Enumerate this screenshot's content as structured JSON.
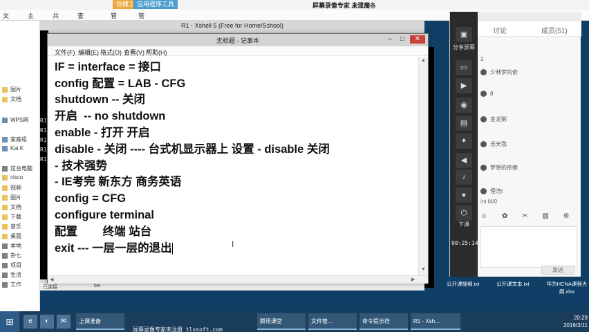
{
  "explorer": {
    "ctx_tab_a": "快捷工具",
    "ctx_tab_b": "应用程序工具",
    "recorder_title": "屏幕录像专家 未注册",
    "window_title": "上课准备",
    "ribbon_tabs": [
      "文件",
      "主页",
      "共享",
      "查看",
      "管理",
      "管理"
    ],
    "nav_items": [
      "图片",
      "文档",
      "WPS网",
      "家庭组",
      "Kai K",
      "这台电脑",
      "cisco",
      "视频",
      "图片",
      "文档",
      "下载",
      "音乐",
      "桌面",
      "本地",
      "杂七",
      "项目",
      "生活",
      "工作"
    ]
  },
  "xshell": {
    "title": "R1 - Xshell 5 (Free for Home/School)",
    "term_lines": [
      "R1",
      "R1",
      "R1",
      "R1",
      "R1"
    ],
    "bottom_text": "已连接",
    "bottom_text2": "bin"
  },
  "notepad": {
    "title": "无标题 - 记事本",
    "menu": [
      "文件(F)",
      "编辑(E)",
      "格式(O)",
      "查看(V)",
      "帮助(H)"
    ],
    "lines": [
      "IF = interface = 接口",
      "config 配置 = LAB - CFG",
      "shutdown -- 关闭",
      "开启  -- no shutdown",
      "enable - 打开 开启",
      "disable - 关闭 ---- 台式机显示器上 设置 - disable 关闭",
      "- 技术强势",
      "- IE考完 新东方 商务英语",
      "config = CFG",
      "configure terminal",
      "配置        终端 站台",
      "exit --- 一层一层的退出"
    ]
  },
  "chat": {
    "share_label": "分享屏幕",
    "tab_discuss": "讨论",
    "tab_members": "成员(51)",
    "messages": [
      {
        "num": "2",
        "text": "少林梦的依"
      },
      {
        "num": "",
        "text": "8"
      },
      {
        "num": "",
        "text": "金龙粥"
      },
      {
        "num": "",
        "text": "乐天我"
      },
      {
        "num": "",
        "text": "梦想的依赖"
      },
      {
        "num": "",
        "text": "俚浩t"
      },
      {
        "num": "",
        "text": "int f4/0"
      }
    ],
    "timer": "00:25:14",
    "send_label": "发送",
    "side_label": "下课"
  },
  "desktop_files": [
    "公开课提纲.txt",
    "公开课文本.txt",
    "华为HCNA课程大纲.xlsx"
  ],
  "taskbar": {
    "apps": [
      "上课准备",
      "腾讯课堂",
      "文件管...",
      "命令提示符",
      "R1 - Xsh..."
    ],
    "time": "20:29",
    "date": "2019/3/11"
  },
  "watermark": "屏幕录像专家未注册 tlxsoft.com"
}
